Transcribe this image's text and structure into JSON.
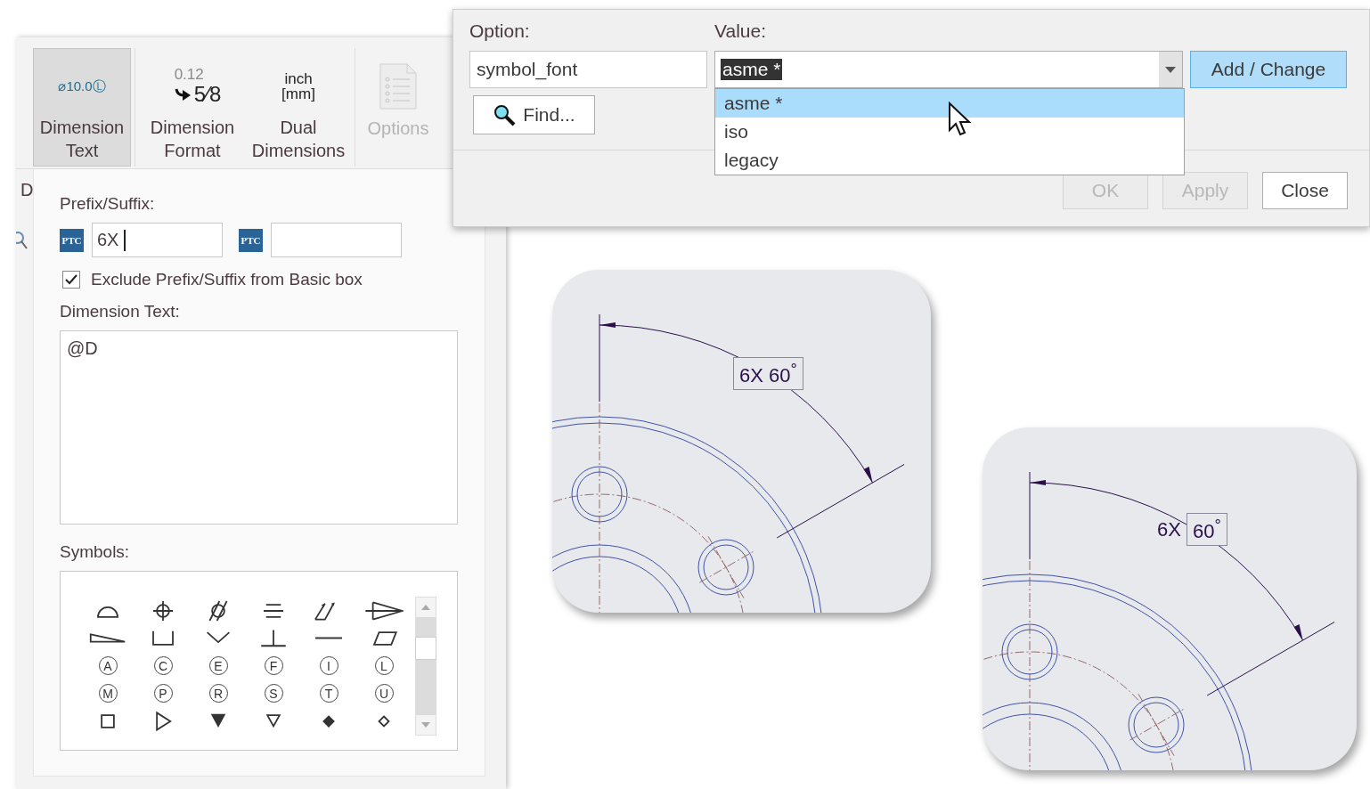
{
  "ribbon": {
    "side_tab": "D",
    "tools": [
      {
        "label": "Dimension Text",
        "kind": "diameter",
        "icon_text": [
          "⌀10.0Ⓛ"
        ],
        "selected": true,
        "disabled": false
      },
      {
        "label": "Dimension Format",
        "kind": "format",
        "icon_text": [
          "0.12",
          "5⁄8"
        ],
        "selected": false,
        "disabled": false
      },
      {
        "label": "Dual Dimensions",
        "kind": "dual",
        "icon_text": [
          "inch",
          "[mm]"
        ],
        "selected": false,
        "disabled": false
      },
      {
        "label": "Options",
        "kind": "document",
        "selected": false,
        "disabled": true
      }
    ]
  },
  "prefix_suffix": {
    "label": "Prefix/Suffix:",
    "fields": [
      {
        "logo": "PTC",
        "value": "6X",
        "focused": true
      },
      {
        "logo": "PTC",
        "focused": false
      }
    ]
  },
  "exclude": {
    "label": "Exclude Prefix/Suffix from Basic box",
    "checked": true
  },
  "dimension_text": {
    "label": "Dimension Text:",
    "value": "@D"
  },
  "symbols": {
    "label": "Symbols:",
    "items": [
      {
        "kind": "semicircle"
      },
      {
        "kind": "crosshair"
      },
      {
        "kind": "cylinder"
      },
      {
        "kind": "triple-line"
      },
      {
        "kind": "double-arrow"
      },
      {
        "kind": "cone"
      },
      {
        "kind": "wedge"
      },
      {
        "kind": "bracket"
      },
      {
        "kind": "chevron"
      },
      {
        "kind": "perpendicular"
      },
      {
        "kind": "dash"
      },
      {
        "kind": "parallelogram"
      },
      {
        "kind": "letter",
        "text": "A"
      },
      {
        "kind": "letter",
        "text": "C"
      },
      {
        "kind": "letter",
        "text": "E"
      },
      {
        "kind": "letter",
        "text": "F"
      },
      {
        "kind": "letter",
        "text": "I"
      },
      {
        "kind": "letter",
        "text": "L"
      },
      {
        "kind": "letter",
        "text": "M"
      },
      {
        "kind": "letter",
        "text": "P"
      },
      {
        "kind": "letter",
        "text": "R"
      },
      {
        "kind": "letter",
        "text": "S"
      },
      {
        "kind": "letter",
        "text": "T"
      },
      {
        "kind": "letter",
        "text": "U"
      },
      {
        "kind": "square"
      },
      {
        "kind": "triangle-right"
      },
      {
        "kind": "triangle-down-filled"
      },
      {
        "kind": "triangle-down"
      },
      {
        "kind": "diamond-filled"
      },
      {
        "kind": "diamond"
      }
    ]
  },
  "dialog": {
    "option_label": "Option:",
    "option_value": "symbol_font",
    "find_button": "Find...",
    "value_label": "Value:",
    "value": "asme *",
    "dropdown": [
      {
        "label": "asme *",
        "selected": true
      },
      {
        "label": "iso",
        "selected": false
      },
      {
        "label": "legacy",
        "selected": false
      }
    ],
    "add_button": "Add / Change",
    "buttons": [
      {
        "label": "OK",
        "disabled": true
      },
      {
        "label": "Apply",
        "disabled": true
      },
      {
        "label": "Close",
        "disabled": false
      }
    ]
  },
  "drawings": [
    {
      "prefix": "6X",
      "value": "60$^{°}$",
      "prefix_boxed": true
    },
    {
      "prefix": "6X",
      "value": "60$^{°}$",
      "prefix_boxed": false
    }
  ]
}
